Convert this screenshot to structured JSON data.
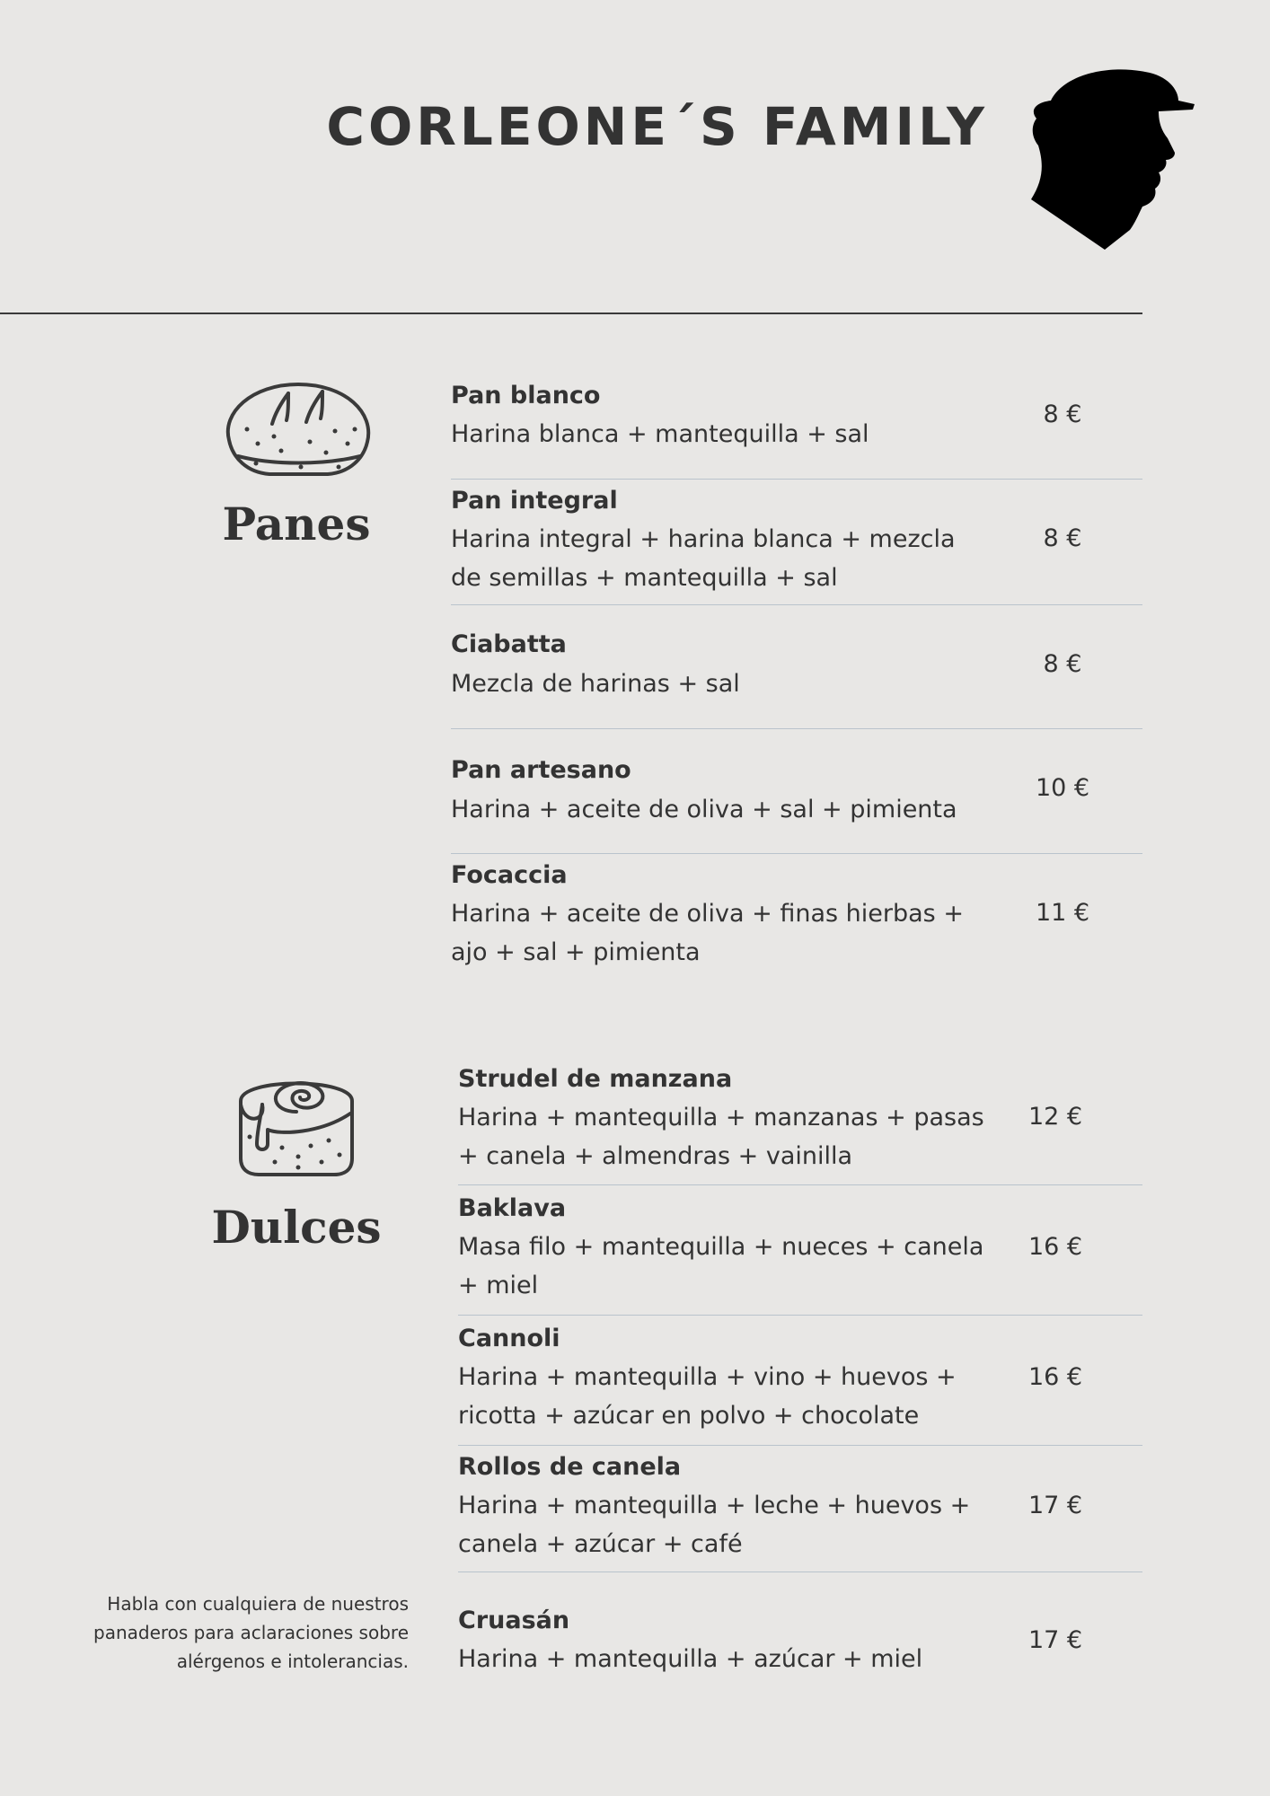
{
  "header": {
    "title": "CORLEONE´S FAMILY",
    "logo_icon": "man-profile-silhouette-icon"
  },
  "sections": {
    "panes": {
      "title": "Panes",
      "icon": "bread-loaf-icon",
      "items": [
        {
          "name": "Pan blanco",
          "desc": "Harina blanca + mantequilla + sal",
          "price": "8 €"
        },
        {
          "name": "Pan integral",
          "desc": "Harina integral + harina blanca + mezcla de semillas + mantequilla + sal",
          "price": "8 €"
        },
        {
          "name": "Ciabatta",
          "desc": "Mezcla de harinas + sal",
          "price": "8 €"
        },
        {
          "name": "Pan artesano",
          "desc": "Harina + aceite de oliva + sal + pimienta",
          "price": "10 €"
        },
        {
          "name": "Focaccia",
          "desc": "Harina + aceite de oliva + finas hierbas + ajo + sal + pimienta",
          "price": "11 €"
        }
      ]
    },
    "dulces": {
      "title": "Dulces",
      "icon": "cinnamon-roll-icon",
      "items": [
        {
          "name": "Strudel de manzana",
          "desc": "Harina + mantequilla + manzanas + pasas + canela + almendras + vainilla",
          "price": "12 €"
        },
        {
          "name": "Baklava",
          "desc": "Masa filo + mantequilla + nueces + canela + miel",
          "price": "16 €"
        },
        {
          "name": "Cannoli",
          "desc": "Harina + mantequilla + vino + huevos + ricotta + azúcar en polvo + chocolate",
          "price": "16 €"
        },
        {
          "name": "Rollos de canela",
          "desc": "Harina + mantequilla + leche + huevos + canela + azúcar + café",
          "price": "17 €"
        },
        {
          "name": "Cruasán",
          "desc": "Harina + mantequilla + azúcar + miel",
          "price": "17 €"
        }
      ]
    }
  },
  "footer": {
    "note": "Habla con cualquiera de nuestros panaderos para aclaraciones sobre alérgenos e intolerancias."
  }
}
